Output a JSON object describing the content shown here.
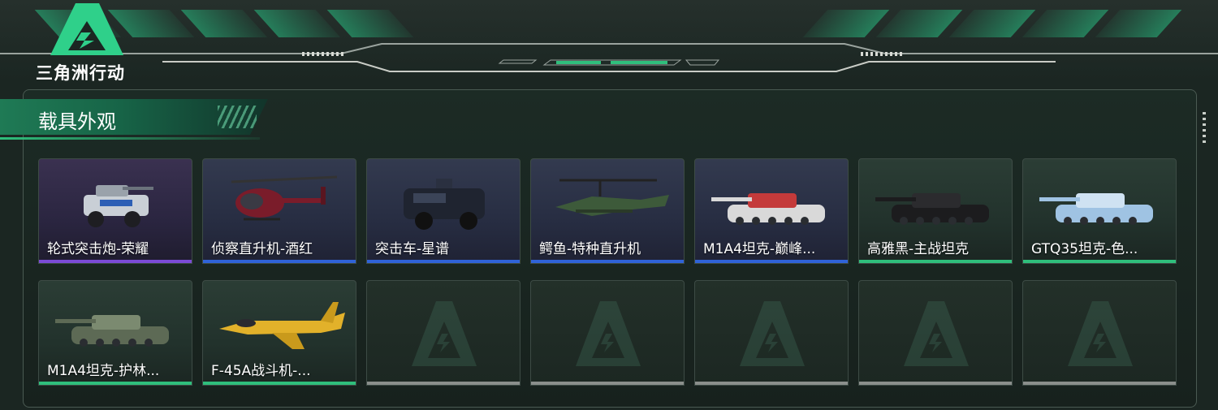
{
  "game": {
    "title": "三角洲行动"
  },
  "colors": {
    "accent": "#2fbf7c",
    "rarity_purple": "#7b4bd6",
    "rarity_blue": "#2f63d8",
    "rarity_green": "#2fbf7c",
    "empty": "#8a8f8c"
  },
  "section": {
    "title": "载具外观"
  },
  "vehicles": [
    {
      "name": "轮式突击炮-荣耀",
      "rarity": "purple",
      "icon": "armored-car-icon"
    },
    {
      "name": "侦察直升机-酒红",
      "rarity": "blue",
      "icon": "scout-helicopter-icon"
    },
    {
      "name": "突击车-星谱",
      "rarity": "blue",
      "icon": "assault-vehicle-icon"
    },
    {
      "name": "鳄鱼-特种直升机",
      "rarity": "blue",
      "icon": "attack-helicopter-icon"
    },
    {
      "name": "M1A4坦克-巅峰...",
      "rarity": "blue",
      "icon": "tank-icon"
    },
    {
      "name": "高雅黑-主战坦克",
      "rarity": "green",
      "icon": "tank-icon"
    },
    {
      "name": "GTQ35坦克-色...",
      "rarity": "green",
      "icon": "tank-icon"
    },
    {
      "name": "M1A4坦克-护林...",
      "rarity": "green",
      "icon": "tank-icon"
    },
    {
      "name": "F-45A战斗机-...",
      "rarity": "green",
      "icon": "fighter-jet-icon"
    }
  ],
  "empty_slots": 5
}
